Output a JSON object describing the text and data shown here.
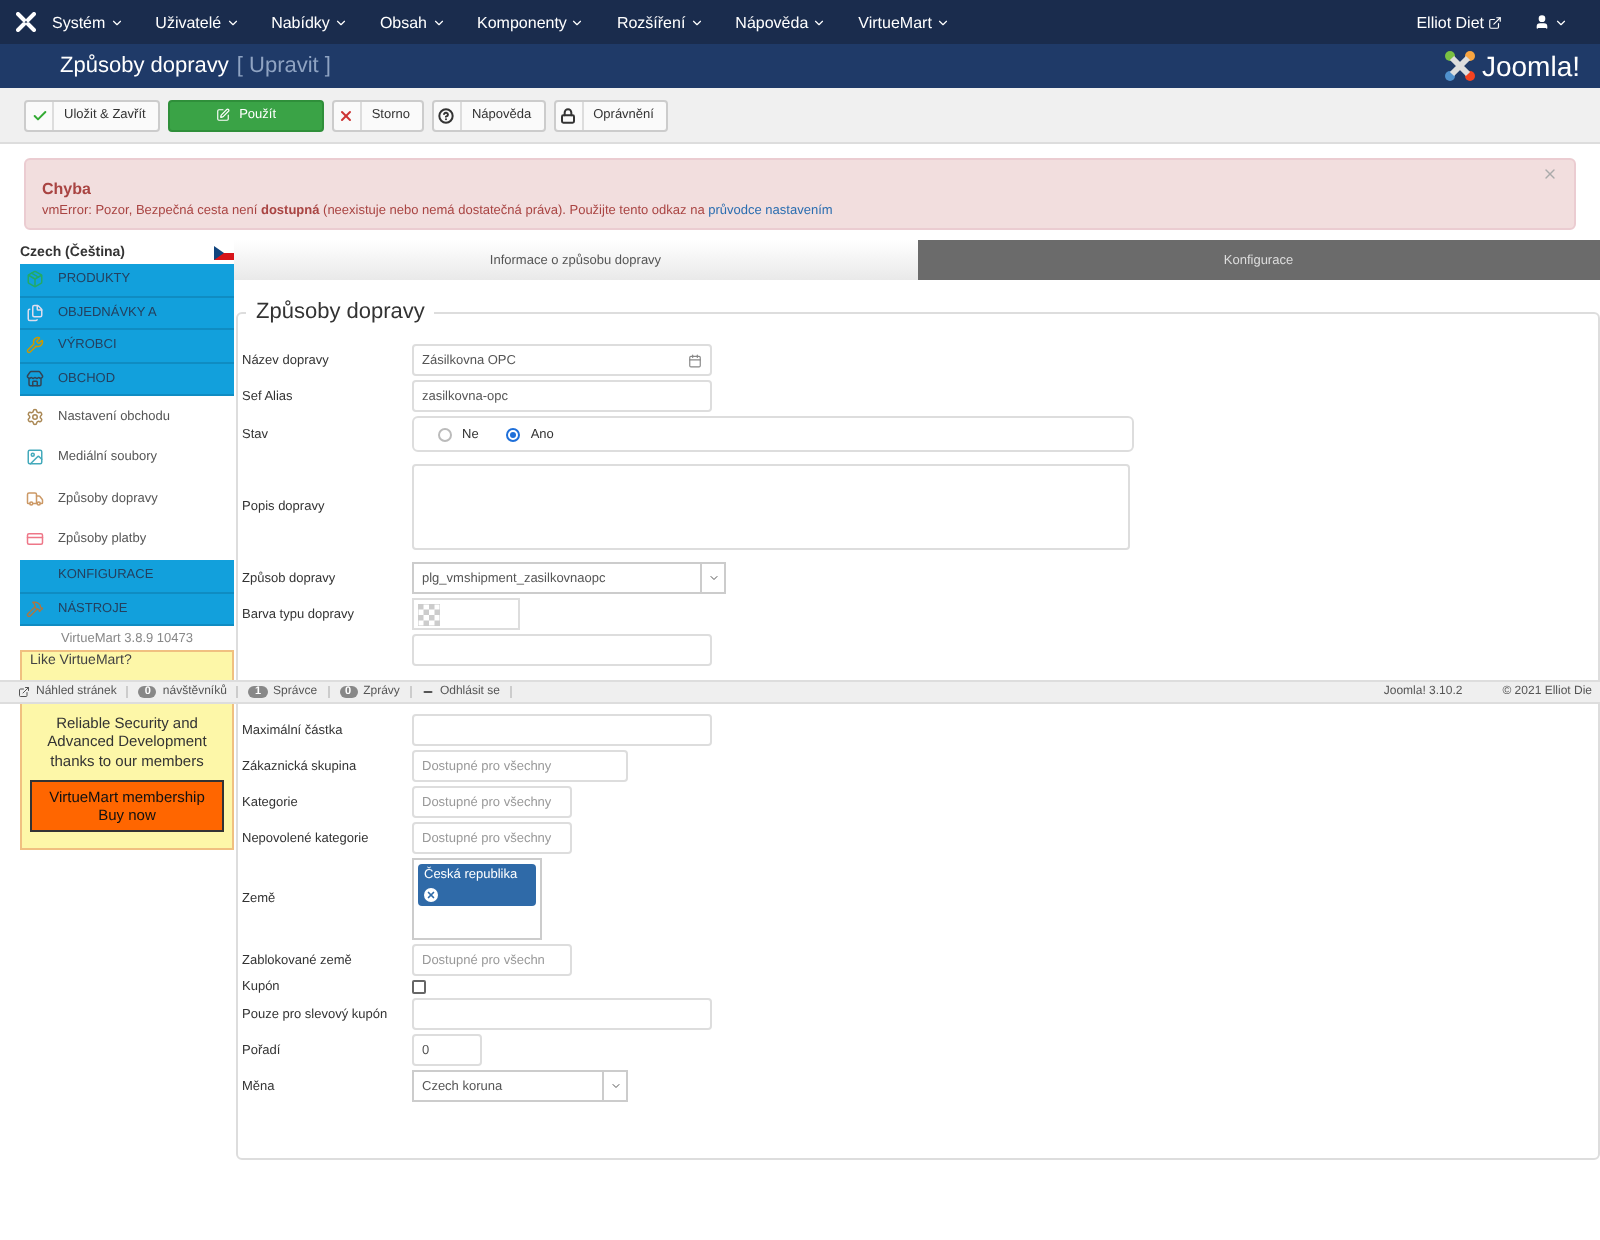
{
  "top_menu": {
    "items": [
      {
        "label": "Systém"
      },
      {
        "label": "Uživatelé"
      },
      {
        "label": "Nabídky"
      },
      {
        "label": "Obsah"
      },
      {
        "label": "Komponenty"
      },
      {
        "label": "Rozšíření"
      },
      {
        "label": "Nápověda"
      },
      {
        "label": "VirtueMart"
      }
    ],
    "user_link": "Elliot Diet"
  },
  "header": {
    "title": "Způsoby dopravy",
    "subtitle": "[ Upravit ]",
    "logo_text": "Joomla!"
  },
  "toolbar": [
    {
      "label": "Uložit & Zavřít",
      "kind": "save"
    },
    {
      "label": "Použít",
      "kind": "apply"
    },
    {
      "label": "Storno",
      "kind": "cancel"
    },
    {
      "label": "Nápověda",
      "kind": "help"
    },
    {
      "label": "Oprávnění",
      "kind": "lock"
    }
  ],
  "alert": {
    "title": "Chyba",
    "message": "vmError: Pozor, Bezpečná cesta není **dostupná** (neexistuje nebo nemá dostatečná práva). Použijte tento odkaz na",
    "link": "průvodce nastavením"
  },
  "sidebar": {
    "language": "Czech (Čeština)",
    "items": [
      {
        "label": "PRODUKTY",
        "kind": "section"
      },
      {
        "label": "OBJEDNÁVKY A",
        "kind": "section"
      },
      {
        "label": "VÝROBCI",
        "kind": "section"
      },
      {
        "label": "OBCHOD",
        "kind": "section"
      },
      {
        "label": "Nastavení obchodu",
        "kind": "item"
      },
      {
        "label": "Mediální soubory",
        "kind": "item"
      },
      {
        "label": "Způsoby dopravy",
        "kind": "item"
      },
      {
        "label": "Způsoby platby",
        "kind": "item"
      },
      {
        "label": "KONFIGURACE",
        "kind": "section"
      },
      {
        "label": "NÁSTROJE",
        "kind": "section"
      }
    ],
    "version": "VirtueMart 3.8.9 10473",
    "promo": {
      "heading": "Like VirtueMart?",
      "text": "Reliable Security and Advanced Development thanks to our members",
      "button": "VirtueMart membership Buy now"
    }
  },
  "tabs": [
    {
      "label": "Informace o způsobu dopravy",
      "selected": true
    },
    {
      "label": "Konfigurace",
      "selected": false
    }
  ],
  "form": {
    "legend": "Způsoby dopravy",
    "rows": [
      {
        "label": "Název dopravy",
        "kind": "text",
        "value": "Zásilkovna OPC"
      },
      {
        "label": "Sef Alias",
        "kind": "text",
        "value": "zasilkovna-opc"
      },
      {
        "label": "Stav",
        "kind": "radio",
        "options": [
          {
            "label": "Ne",
            "selected": false
          },
          {
            "label": "Ano",
            "selected": true
          }
        ]
      },
      {
        "label": "Popis dopravy",
        "kind": "textarea"
      },
      {
        "label": "Způsob dopravy",
        "kind": "select",
        "value": "plg_vmshipment_zasilkovnaopc"
      },
      {
        "label": "Barva typu dopravy",
        "kind": "color"
      },
      {
        "kind": "text"
      },
      {
        "label": "Maximální částka",
        "kind": "text"
      },
      {
        "label": "Zákaznická skupina",
        "kind": "text",
        "placeholder": "Dostupné pro všechny"
      },
      {
        "label": "Kategorie",
        "kind": "text",
        "placeholder": "Dostupné pro všechny"
      },
      {
        "label": "Nepovolené kategorie",
        "kind": "text",
        "placeholder": "Dostupné pro všechny"
      },
      {
        "label": "Země",
        "kind": "multiselect",
        "chips": [
          "Česká republika"
        ]
      },
      {
        "label": "Zablokované země",
        "kind": "text",
        "placeholder": "Dostupné pro všechn"
      },
      {
        "label": "Kupón",
        "kind": "checkbox",
        "checked": false
      },
      {
        "label": "Pouze pro slevový kupón",
        "kind": "text"
      },
      {
        "label": "Pořadí",
        "kind": "text",
        "value": "0"
      },
      {
        "label": "Měna",
        "kind": "select",
        "value": "Czech koruna"
      }
    ]
  },
  "status_bar": {
    "items": [
      {
        "label": "Náhled stránek",
        "kind": "link"
      },
      {
        "label": "návštěvníků",
        "count": "0",
        "kind": "badge"
      },
      {
        "label": "Správce",
        "count": "1",
        "kind": "badge"
      },
      {
        "label": "Zprávy",
        "count": "0",
        "kind": "badge"
      },
      {
        "label": "Odhlásit se",
        "kind": "logout"
      }
    ],
    "version": "Joomla! 3.10.2",
    "copyright": "© 2021 Elliot Die"
  }
}
